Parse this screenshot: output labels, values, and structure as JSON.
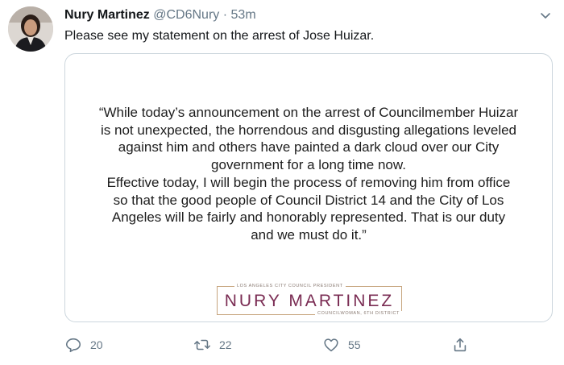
{
  "tweet": {
    "display_name": "Nury Martinez",
    "handle": "@CD6Nury",
    "separator": "·",
    "time": "53m",
    "text": "Please see my statement on the arrest of Jose Huizar."
  },
  "card": {
    "statement_lines": [
      "“While today’s announcement on the arrest of Councilmember Huizar",
      "is not unexpected, the horrendous and disgusting allegations leveled",
      "against him and others have painted a dark cloud over our City",
      "government for a long time now.",
      "Effective today, I will begin the process of removing him from office",
      "so that the good people of Council District 14 and the City of Los",
      "Angeles will be fairly and honorably represented. That is our duty",
      "and we must do it.”"
    ],
    "logo": {
      "top": "LOS ANGELES CITY COUNCIL PRESIDENT",
      "name": "NURY MARTINEZ",
      "bottom": "COUNCILWOMAN, 6TH DISTRICT"
    }
  },
  "actions": {
    "reply_count": "20",
    "retweet_count": "22",
    "like_count": "55"
  },
  "icons": {
    "reply": "reply-icon",
    "retweet": "retweet-icon",
    "like": "like-icon",
    "share": "share-icon",
    "menu": "chevron-down-icon"
  },
  "colors": {
    "text": "#14171a",
    "secondary": "#657786",
    "border": "#ccd6dd",
    "logo_name": "#7a2c53",
    "logo_gold": "#c7a57e"
  }
}
